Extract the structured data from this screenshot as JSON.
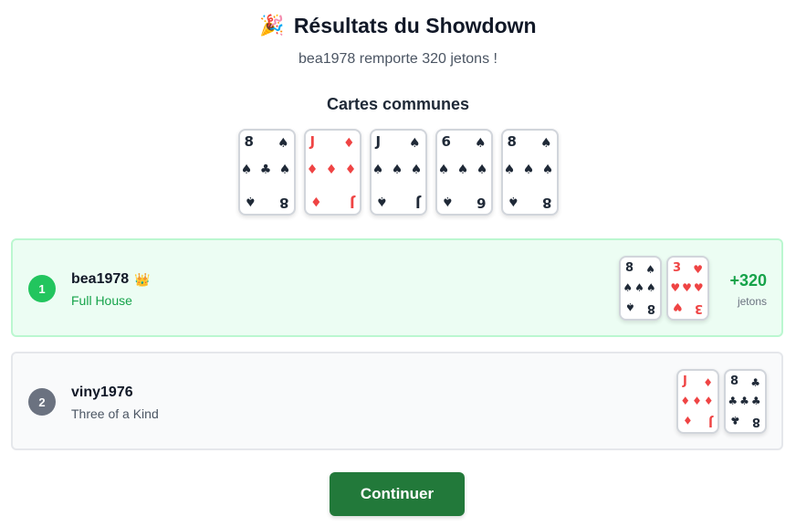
{
  "header": {
    "icon": "party-popper-icon",
    "title": "Résultats du Showdown",
    "subtitle": "bea1978 remporte 320 jetons !"
  },
  "community": {
    "title": "Cartes communes",
    "cards": [
      {
        "rank": "8",
        "suit": "♠",
        "center": "♠ ♣ ♠",
        "color": "black"
      },
      {
        "rank": "J",
        "suit": "♦",
        "center": "♦ ♦ ♦",
        "color": "red"
      },
      {
        "rank": "J",
        "suit": "♠",
        "center": "♠ ♠ ♠",
        "color": "black"
      },
      {
        "rank": "6",
        "suit": "♠",
        "center": "♠ ♠ ♠",
        "color": "black"
      },
      {
        "rank": "8",
        "suit": "♠",
        "center": "♠ ♠ ♠",
        "color": "black"
      }
    ]
  },
  "players": [
    {
      "position": "1",
      "name": "bea1978",
      "crown": "👑",
      "hand": "Full House",
      "winnings": "+320",
      "winnings_unit": "jetons",
      "cards": [
        {
          "rank": "8",
          "suit": "♠",
          "center": "♠♠♠",
          "color": "black"
        },
        {
          "rank": "3",
          "suit": "♥",
          "center": "♥♥♥",
          "color": "red"
        }
      ]
    },
    {
      "position": "2",
      "name": "viny1976",
      "hand": "Three of a Kind",
      "cards": [
        {
          "rank": "J",
          "suit": "♦",
          "center": "♦♦♦",
          "color": "red"
        },
        {
          "rank": "8",
          "suit": "♣",
          "center": "♣♣♣",
          "color": "black"
        }
      ]
    }
  ],
  "actions": {
    "continue_label": "Continuer"
  },
  "colors": {
    "winner_bg": "#ecfdf3",
    "winner_accent": "#22c55e",
    "button": "#22793a",
    "red_suit": "#ef4444"
  }
}
